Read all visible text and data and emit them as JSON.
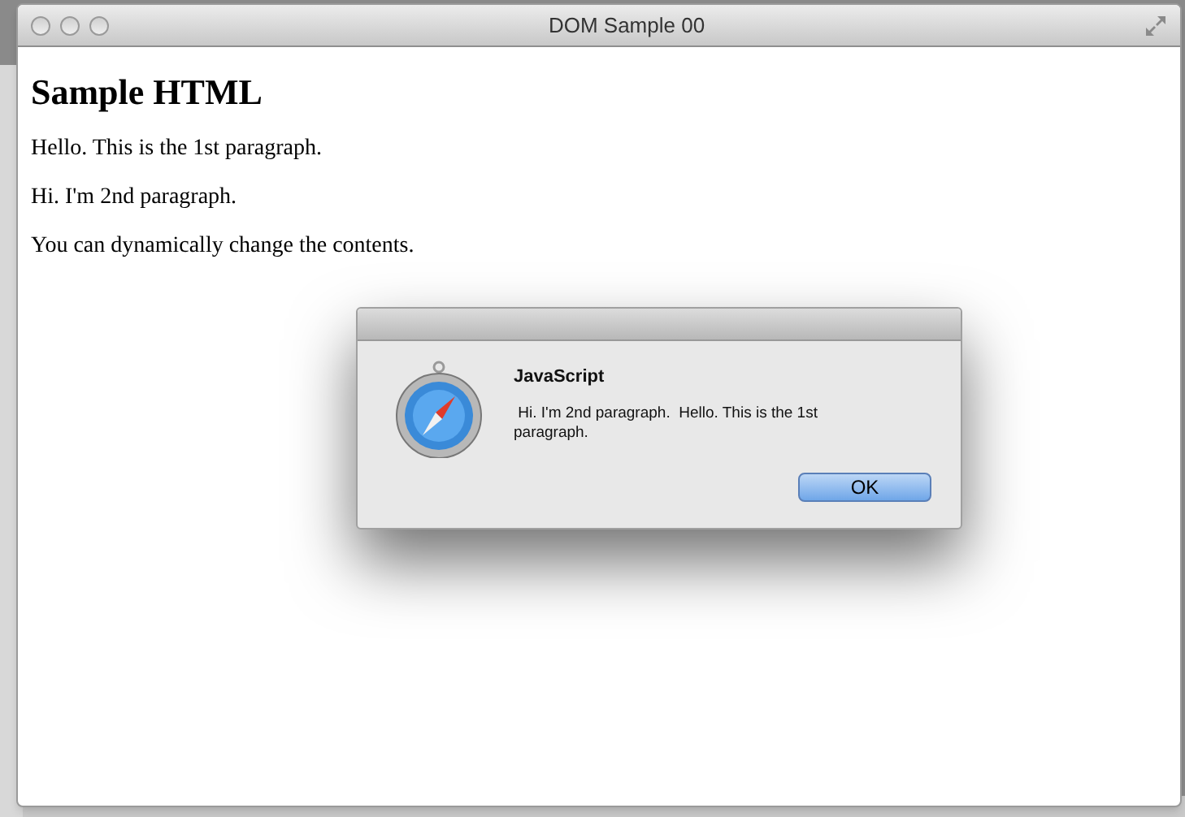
{
  "window": {
    "title": "DOM Sample 00"
  },
  "page": {
    "heading": "Sample HTML",
    "paragraphs": [
      "Hello. This is the 1st paragraph.",
      "Hi. I'm 2nd paragraph.",
      "You can dynamically change the contents."
    ]
  },
  "dialog": {
    "title": "JavaScript",
    "message": " Hi. I'm 2nd paragraph.  Hello. This is the 1st paragraph.",
    "buttons": [
      "OK"
    ]
  }
}
